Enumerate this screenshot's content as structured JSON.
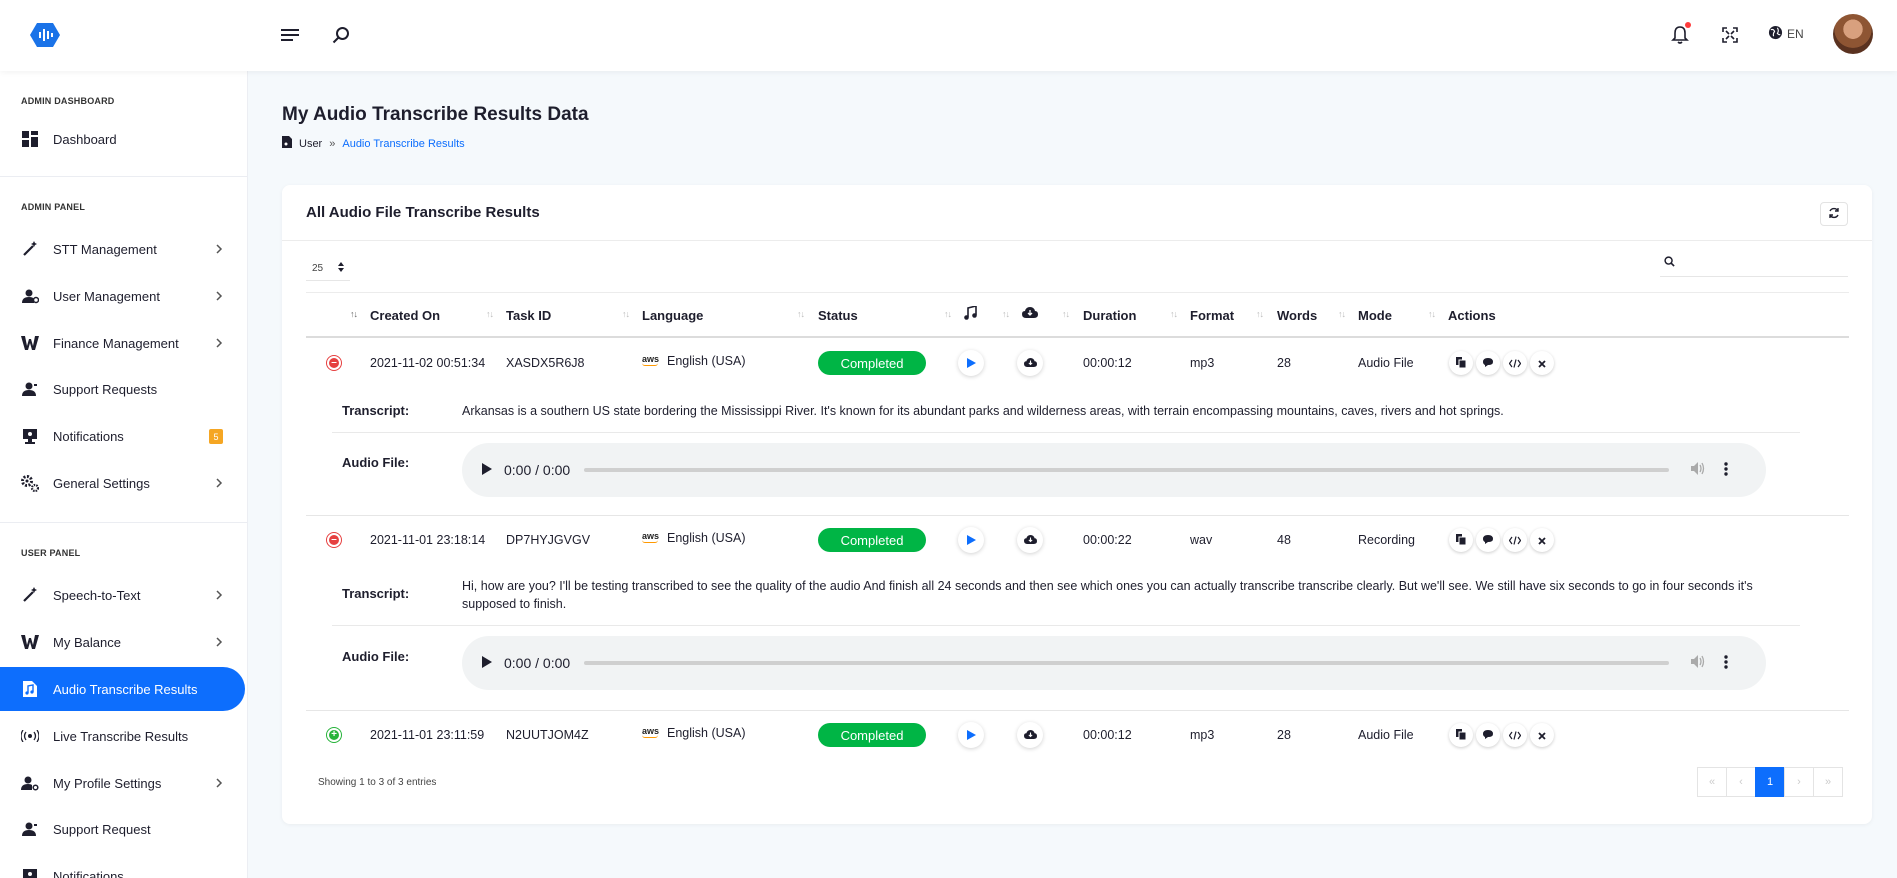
{
  "header": {
    "language": "EN"
  },
  "sidebar": {
    "sections": [
      "ADMIN DASHBOARD",
      "ADMIN PANEL",
      "USER PANEL"
    ],
    "items": [
      {
        "label": "Dashboard",
        "icon": "grid-icon"
      },
      {
        "label": "STT Management",
        "icon": "magic-wand-icon"
      },
      {
        "label": "User Management",
        "icon": "users-cog-icon"
      },
      {
        "label": "Finance Management",
        "icon": "finance-icon"
      },
      {
        "label": "Support Requests",
        "icon": "support-icon"
      },
      {
        "label": "Notifications",
        "icon": "monitor-bell-icon",
        "badge": "5"
      },
      {
        "label": "General Settings",
        "icon": "gears-icon"
      },
      {
        "label": "Speech-to-Text",
        "icon": "magic-wand-icon"
      },
      {
        "label": "My Balance",
        "icon": "balance-icon"
      },
      {
        "label": "Audio Transcribe Results",
        "icon": "audio-file-icon",
        "active": true
      },
      {
        "label": "Live Transcribe Results",
        "icon": "broadcast-icon"
      },
      {
        "label": "My Profile Settings",
        "icon": "user-cog-icon"
      },
      {
        "label": "Support Request",
        "icon": "support-icon"
      },
      {
        "label": "Notifications",
        "icon": "monitor-bell-icon"
      }
    ]
  },
  "page": {
    "title": "My Audio Transcribe Results Data",
    "breadcrumb": [
      "User",
      "Audio Transcribe Results"
    ]
  },
  "card": {
    "title": "All Audio File Transcribe Results",
    "page_length": "25",
    "columns": [
      "Created On",
      "Task ID",
      "Language",
      "Status",
      "Duration",
      "Format",
      "Words",
      "Mode",
      "Actions"
    ],
    "rows": [
      {
        "created": "2021-11-02 00:51:34",
        "task_id": "XASDX5R6J8",
        "language": "English (USA)",
        "status": "Completed",
        "duration": "00:00:12",
        "format": "mp3",
        "words": "28",
        "mode": "Audio File",
        "expanded": true,
        "transcript": "Arkansas is a southern US state bordering the Mississippi River. It's known for its abundant parks and wilderness areas, with terrain encompassing mountains, caves, rivers and hot springs.",
        "player_time": "0:00 / 0:00"
      },
      {
        "created": "2021-11-01 23:18:14",
        "task_id": "DP7HYJGVGV",
        "language": "English (USA)",
        "status": "Completed",
        "duration": "00:00:22",
        "format": "wav",
        "words": "48",
        "mode": "Recording",
        "expanded": true,
        "transcript": "Hi, how are you? I'll be testing transcribed to see the quality of the audio And finish all 24 seconds and then see which ones you can actually transcribe transcribe clearly. But we'll see. We still have six seconds to go in four seconds it's supposed to finish.",
        "player_time": "0:00 / 0:00"
      },
      {
        "created": "2021-11-01 23:11:59",
        "task_id": "N2UUTJOM4Z",
        "language": "English (USA)",
        "status": "Completed",
        "duration": "00:00:12",
        "format": "mp3",
        "words": "28",
        "mode": "Audio File",
        "expanded": false
      }
    ],
    "detail_labels": {
      "transcript": "Transcript:",
      "audio": "Audio File:"
    },
    "info": "Showing 1 to 3 of 3 entries",
    "current_page": "1"
  },
  "colors": {
    "accent": "#0d6efd",
    "status_completed": "#00b545",
    "badge": "#f5a623"
  }
}
